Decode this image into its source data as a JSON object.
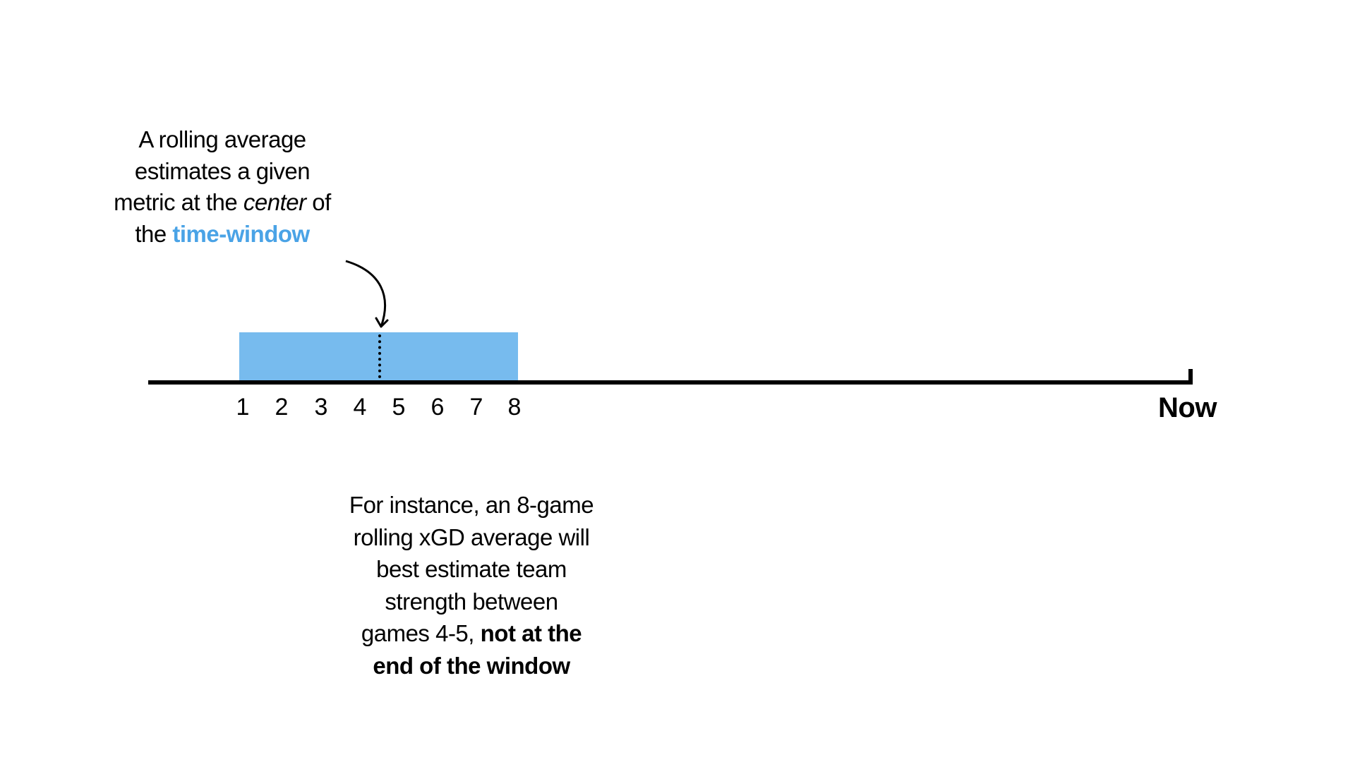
{
  "topCaption": {
    "line1": "A rolling average",
    "line2": "estimates a given",
    "line3a": "metric at the ",
    "line3b_italic": "center",
    "line3c": " of",
    "line4a": "the ",
    "line4b_blue": "time-window"
  },
  "ticks": [
    "1",
    "2",
    "3",
    "4",
    "5",
    "6",
    "7",
    "8"
  ],
  "nowLabel": "Now",
  "bottomCaption": {
    "line1": "For instance, an 8-game",
    "line2": "rolling xGD average will",
    "line3": "best estimate team",
    "line4": "strength between",
    "line5a": "games 4-5, ",
    "line5b_bold": "not at the",
    "line6_bold": "end of the window"
  },
  "colors": {
    "window": "#77bbee",
    "blueText": "#4aa3e6"
  }
}
